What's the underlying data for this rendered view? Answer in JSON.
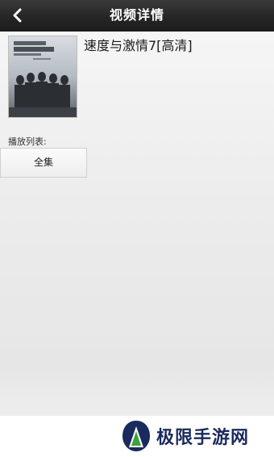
{
  "header": {
    "title": "视频详情",
    "back_icon": "chevron-left-icon"
  },
  "movie": {
    "title": "速度与激情7[高清]"
  },
  "playlist": {
    "label": "播放列表:",
    "episodes": [
      "全集"
    ]
  },
  "watermark": {
    "text": "极限手游网"
  },
  "colors": {
    "header_bg": "#262626",
    "header_text": "#ffffff",
    "watermark_text": "#1b2a5c",
    "watermark_logo_dark": "#1b2a5c",
    "watermark_logo_green": "#3aa53a"
  }
}
